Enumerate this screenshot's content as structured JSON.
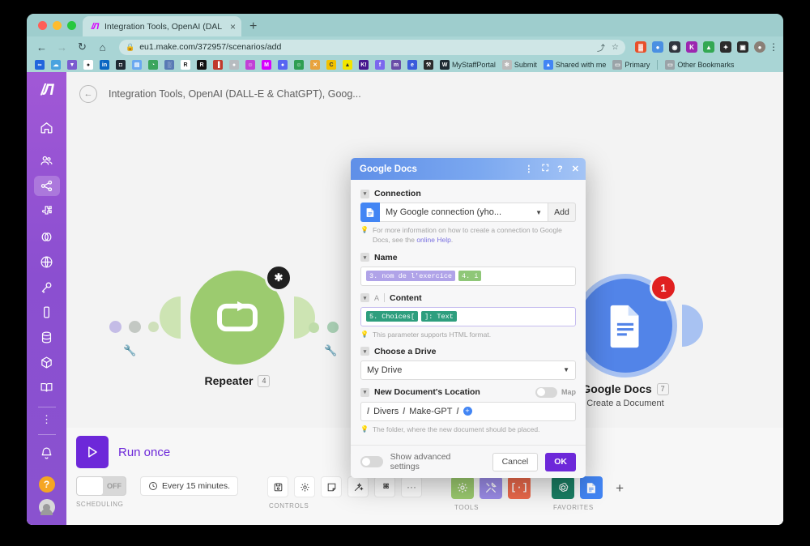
{
  "browser": {
    "tab": {
      "title": "Integration Tools, OpenAI (DAL",
      "close": "×",
      "favicon": "make-logo-icon"
    },
    "newtab_label": "+",
    "nav": {
      "back": "←",
      "forward": "→",
      "reload": "↻",
      "home": "⌂"
    },
    "omnibox": {
      "lock": "🔒",
      "url": "eu1.make.com/372957/scenarios/add",
      "share": "⤴",
      "bookmark": "☆"
    },
    "extensions": [
      {
        "name": "ext-red-icon",
        "glyph": "▓",
        "color": "#e8502a"
      },
      {
        "name": "ext-blue-dot-icon",
        "glyph": "●",
        "color": "#4a90e2"
      },
      {
        "name": "ext-dark-icon",
        "glyph": "◉",
        "color": "#31353f"
      },
      {
        "name": "ext-kaspersky-icon",
        "glyph": "K",
        "color": "#9c27b0"
      },
      {
        "name": "ext-drive-icon",
        "glyph": "▲",
        "color": "#34a853"
      },
      {
        "name": "ext-puzzle-icon",
        "glyph": "✦",
        "color": "#2b2b2b"
      },
      {
        "name": "ext-sidepanel-icon",
        "glyph": "▣",
        "color": "#2b2b2b"
      },
      {
        "name": "profile-avatar",
        "glyph": "●",
        "color": "#8a7f76"
      }
    ],
    "menu_glyph": "⋮",
    "bookmarks": [
      {
        "name": "bookmark-infinity",
        "glyph": "∞",
        "color": "#2266dd",
        "label": ""
      },
      {
        "name": "bookmark-cloud",
        "glyph": "☁",
        "color": "#4aa3df",
        "label": ""
      },
      {
        "name": "bookmark-drop",
        "glyph": "▼",
        "color": "#7b5ccf",
        "label": ""
      },
      {
        "name": "bookmark-github",
        "glyph": "●",
        "color": "#ffffff",
        "label": ""
      },
      {
        "name": "bookmark-linkedin",
        "glyph": "in",
        "color": "#0a66c2",
        "label": ""
      },
      {
        "name": "bookmark-chat",
        "glyph": "◘",
        "color": "#1f2a33",
        "label": ""
      },
      {
        "name": "bookmark-docs",
        "glyph": "▤",
        "color": "#6aa8f0",
        "label": ""
      },
      {
        "name": "bookmark-leaf",
        "glyph": "◔",
        "color": "#3ba55d",
        "label": ""
      },
      {
        "name": "bookmark-building",
        "glyph": "░",
        "color": "#5a7ab5",
        "label": ""
      },
      {
        "name": "bookmark-r-light",
        "glyph": "R",
        "color": "#ffffff",
        "label": ""
      },
      {
        "name": "bookmark-r-dark",
        "glyph": "R",
        "color": "#111111",
        "label": ""
      },
      {
        "name": "bookmark-books",
        "glyph": "▐",
        "color": "#c0392b",
        "label": ""
      },
      {
        "name": "bookmark-grey",
        "glyph": "●",
        "color": "#b7bcc0",
        "label": ""
      },
      {
        "name": "bookmark-smiley",
        "glyph": "☺",
        "color": "#c13fd6",
        "label": ""
      },
      {
        "name": "bookmark-make",
        "glyph": "M",
        "color": "#d600ff",
        "label": ""
      },
      {
        "name": "bookmark-discord",
        "glyph": "●",
        "color": "#5865f2",
        "label": ""
      },
      {
        "name": "bookmark-green-face",
        "glyph": "☺",
        "color": "#2e9e52",
        "label": ""
      },
      {
        "name": "bookmark-x",
        "glyph": "✕",
        "color": "#e8a33d",
        "label": ""
      },
      {
        "name": "bookmark-c-gold",
        "glyph": "C",
        "color": "#f2c200",
        "label": ""
      },
      {
        "name": "bookmark-yellow",
        "glyph": "▲",
        "color": "#f2e600",
        "label": ""
      },
      {
        "name": "bookmark-k",
        "glyph": "K!",
        "color": "#46178f",
        "label": ""
      },
      {
        "name": "bookmark-f",
        "glyph": "f",
        "color": "#7b68ee",
        "label": ""
      },
      {
        "name": "bookmark-m-circle",
        "glyph": "m",
        "color": "#6a4ea8",
        "label": ""
      },
      {
        "name": "bookmark-e-circle",
        "glyph": "e",
        "color": "#3b5bdb",
        "label": ""
      },
      {
        "name": "bookmark-tools",
        "glyph": "⚒",
        "color": "#2b2b2b",
        "label": ""
      },
      {
        "name": "bookmark-mystaffportal",
        "glyph": "W",
        "color": "#1f2a33",
        "label": "MyStaffPortal"
      },
      {
        "name": "bookmark-submit",
        "glyph": "✻",
        "color": "#bbbbbb",
        "label": "Submit"
      },
      {
        "name": "bookmark-shared-with-me",
        "glyph": "▲",
        "color": "#4285f4",
        "label": "Shared with me"
      },
      {
        "name": "bookmark-primary-folder",
        "glyph": "▭",
        "color": "#9aa3a8",
        "label": "Primary"
      }
    ],
    "other_bookmarks": {
      "glyph": "▭",
      "label": "Other Bookmarks"
    }
  },
  "sidebar": {
    "logo": "M",
    "items": [
      {
        "name": "sidebar-item-home",
        "icon": "home-icon"
      },
      {
        "name": "sidebar-item-team",
        "icon": "people-icon"
      },
      {
        "name": "sidebar-item-scenarios",
        "icon": "share-nodes-icon"
      },
      {
        "name": "sidebar-item-templates",
        "icon": "puzzle-icon"
      },
      {
        "name": "sidebar-item-connections",
        "icon": "link-icon"
      },
      {
        "name": "sidebar-item-webhooks",
        "icon": "globe-icon"
      },
      {
        "name": "sidebar-item-keys",
        "icon": "key-icon"
      },
      {
        "name": "sidebar-item-devices",
        "icon": "device-icon"
      },
      {
        "name": "sidebar-item-datastores",
        "icon": "database-icon"
      },
      {
        "name": "sidebar-item-apps",
        "icon": "cube-icon"
      },
      {
        "name": "sidebar-item-docs",
        "icon": "book-icon"
      }
    ],
    "more": "⋮",
    "notifications_icon": "bell-icon",
    "help_label": "?",
    "avatar": "user-avatar"
  },
  "scenario": {
    "back_glyph": "←",
    "title": "Integration Tools, OpenAI (DALL-E & ChatGPT), Goog...",
    "modules": [
      {
        "name": "Repeater",
        "badge": "4",
        "subtitle": "",
        "color": "#9ccb6f",
        "corner_badge": "✱",
        "corner_color": "#202020"
      },
      {
        "name": "Google Docs",
        "badge": "7",
        "subtitle": "Create a Document",
        "color": "#5284e8",
        "corner_badge": "1",
        "corner_color": "#e02020"
      }
    ]
  },
  "bottom": {
    "run_once": "Run once",
    "run_icon": "play-icon",
    "scheduling": {
      "toggle_state": "OFF",
      "schedule_icon": "clock-icon",
      "schedule_label": "Every 15 minutes.",
      "group_label": "SCHEDULING"
    },
    "controls": {
      "group_label": "CONTROLS",
      "items": [
        {
          "name": "save-button",
          "icon": "floppy-icon",
          "glyph": "▣"
        },
        {
          "name": "settings-button",
          "icon": "gear-icon",
          "glyph": "⚙"
        },
        {
          "name": "notes-button",
          "icon": "note-icon",
          "glyph": "◱"
        },
        {
          "name": "autoalign-button",
          "icon": "magic-wand-icon",
          "glyph": "✧"
        },
        {
          "name": "explain-flow-button",
          "icon": "puzzle-icon",
          "glyph": "✥"
        },
        {
          "name": "more-button",
          "icon": "ellipsis-icon",
          "glyph": "⋯"
        }
      ]
    },
    "tools": {
      "group_label": "TOOLS",
      "items": [
        {
          "name": "tools-button",
          "icon": "gear-icon",
          "glyph": "⚙",
          "color": "#9ccb6f"
        },
        {
          "name": "flow-control-button",
          "icon": "tools-icon",
          "glyph": "⚒",
          "color": "#9b8ce8"
        },
        {
          "name": "text-parser-button",
          "icon": "brackets-icon",
          "glyph": "[·]",
          "color": "#ec6a4c"
        }
      ]
    },
    "favorites": {
      "group_label": "FAVORITES",
      "items": [
        {
          "name": "favorite-openai",
          "icon": "openai-icon",
          "glyph": "✻",
          "color": "#1a7f64"
        },
        {
          "name": "favorite-google-docs",
          "icon": "google-docs-icon",
          "glyph": "▤",
          "color": "#4285f4"
        }
      ],
      "add": "+"
    }
  },
  "modal": {
    "title": "Google Docs",
    "header_actions": [
      {
        "name": "modal-menu-icon",
        "glyph": "⋮"
      },
      {
        "name": "modal-expand-icon",
        "glyph": "⛶"
      },
      {
        "name": "modal-help-icon",
        "glyph": "?"
      },
      {
        "name": "modal-close-icon",
        "glyph": "✕"
      }
    ],
    "fields": {
      "connection": {
        "label": "Connection",
        "value": "My Google connection (yho...",
        "add_label": "Add",
        "hint_pre": "For more information on how to create a connection to Google Docs, see the ",
        "hint_link": "online Help",
        "hint_post": "."
      },
      "name": {
        "label": "Name",
        "tokens": [
          {
            "text": "3. nom de l'exercice",
            "style": "purple"
          },
          {
            "text": "4. i",
            "style": "green"
          }
        ]
      },
      "content": {
        "label": "Content",
        "type_glyph": "A",
        "tokens": [
          {
            "text": "5. Choices[",
            "style": "teal"
          },
          {
            "text": "]: Text",
            "style": "teal"
          }
        ],
        "hint": "This parameter supports HTML format."
      },
      "drive": {
        "label": "Choose a Drive",
        "value": "My Drive"
      },
      "location": {
        "label": "New Document's Location",
        "map_label": "Map",
        "path": [
          "Divers",
          "Make-GPT"
        ],
        "add_glyph": "+",
        "hint": "The folder, where the new document should be placed."
      }
    },
    "footer": {
      "advanced_label": "Show advanced settings",
      "cancel_label": "Cancel",
      "ok_label": "OK"
    }
  },
  "colors": {
    "accent_purple": "#6d28d9",
    "repeater_green": "#9ccb6f",
    "gdocs_blue": "#5284e8",
    "error_red": "#e02020"
  }
}
